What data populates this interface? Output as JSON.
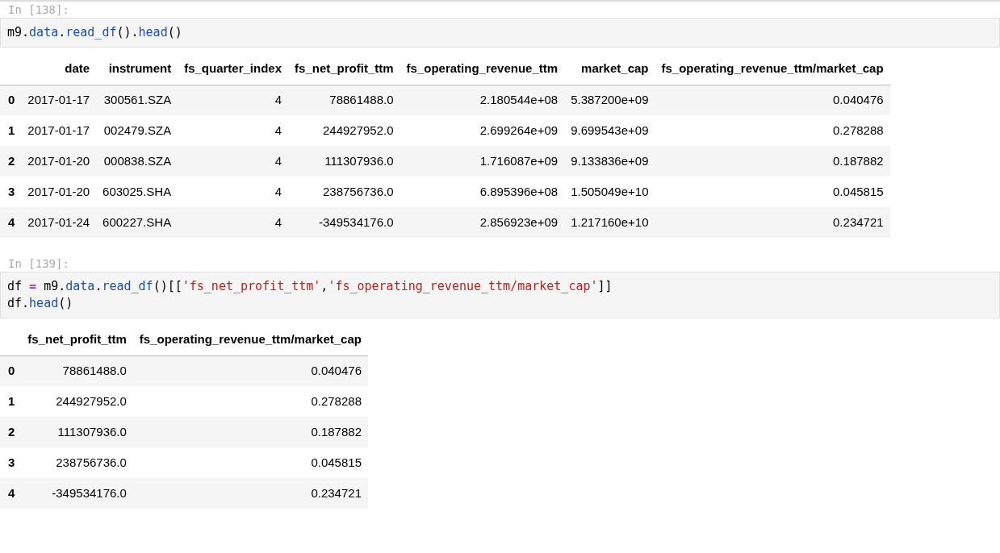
{
  "cells": [
    {
      "prompt": "In [138]:",
      "code": [
        [
          {
            "text": "m9.",
            "kind": "plain"
          },
          {
            "text": "data",
            "kind": "attr"
          },
          {
            "text": ".",
            "kind": "plain"
          },
          {
            "text": "read_df",
            "kind": "attr"
          },
          {
            "text": "().",
            "kind": "plain"
          },
          {
            "text": "head",
            "kind": "attr"
          },
          {
            "text": "()",
            "kind": "plain"
          }
        ]
      ],
      "output": {
        "columns": [
          "date",
          "instrument",
          "fs_quarter_index",
          "fs_net_profit_ttm",
          "fs_operating_revenue_ttm",
          "market_cap",
          "fs_operating_revenue_ttm/market_cap"
        ],
        "rows": [
          {
            "index": "0",
            "values": [
              "2017-01-17",
              "300561.SZA",
              "4",
              "78861488.0",
              "2.180544e+08",
              "5.387200e+09",
              "0.040476"
            ]
          },
          {
            "index": "1",
            "values": [
              "2017-01-17",
              "002479.SZA",
              "4",
              "244927952.0",
              "2.699264e+09",
              "9.699543e+09",
              "0.278288"
            ]
          },
          {
            "index": "2",
            "values": [
              "2017-01-20",
              "000838.SZA",
              "4",
              "111307936.0",
              "1.716087e+09",
              "9.133836e+09",
              "0.187882"
            ]
          },
          {
            "index": "3",
            "values": [
              "2017-01-20",
              "603025.SHA",
              "4",
              "238756736.0",
              "6.895396e+08",
              "1.505049e+10",
              "0.045815"
            ]
          },
          {
            "index": "4",
            "values": [
              "2017-01-24",
              "600227.SHA",
              "4",
              "-349534176.0",
              "2.856923e+09",
              "1.217160e+10",
              "0.234721"
            ]
          }
        ]
      }
    },
    {
      "prompt": "In [139]:",
      "code": [
        [
          {
            "text": "df ",
            "kind": "plain"
          },
          {
            "text": "=",
            "kind": "op"
          },
          {
            "text": " m9.",
            "kind": "plain"
          },
          {
            "text": "data",
            "kind": "attr"
          },
          {
            "text": ".",
            "kind": "plain"
          },
          {
            "text": "read_df",
            "kind": "attr"
          },
          {
            "text": "()[[",
            "kind": "plain"
          },
          {
            "text": "'fs_net_profit_ttm'",
            "kind": "str"
          },
          {
            "text": ",",
            "kind": "plain"
          },
          {
            "text": "'fs_operating_revenue_ttm/market_cap'",
            "kind": "str"
          },
          {
            "text": "]]",
            "kind": "plain"
          }
        ],
        [
          {
            "text": "df.",
            "kind": "plain"
          },
          {
            "text": "head",
            "kind": "attr"
          },
          {
            "text": "()",
            "kind": "plain"
          }
        ]
      ],
      "output": {
        "columns": [
          "fs_net_profit_ttm",
          "fs_operating_revenue_ttm/market_cap"
        ],
        "rows": [
          {
            "index": "0",
            "values": [
              "78861488.0",
              "0.040476"
            ]
          },
          {
            "index": "1",
            "values": [
              "244927952.0",
              "0.278288"
            ]
          },
          {
            "index": "2",
            "values": [
              "111307936.0",
              "0.187882"
            ]
          },
          {
            "index": "3",
            "values": [
              "238756736.0",
              "0.045815"
            ]
          },
          {
            "index": "4",
            "values": [
              "-349534176.0",
              "0.234721"
            ]
          }
        ]
      }
    }
  ]
}
